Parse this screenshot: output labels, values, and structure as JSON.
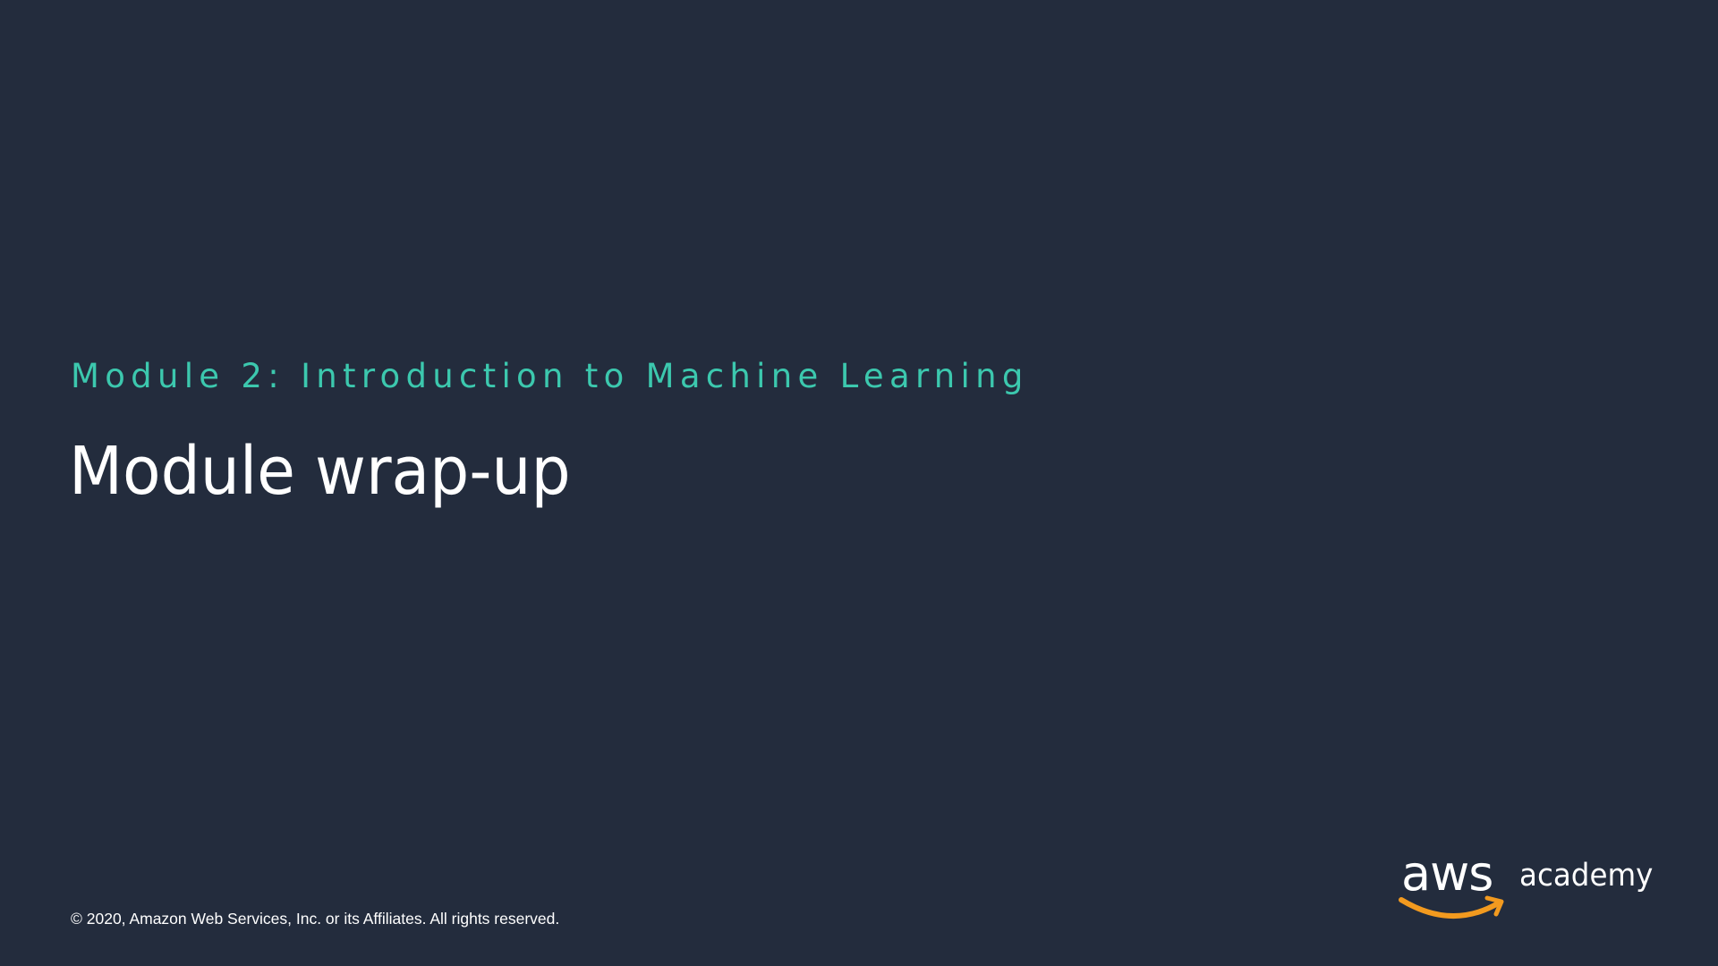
{
  "slide": {
    "module_label": "Module 2: Introduction to Machine Learning",
    "title": "Module wrap-up",
    "copyright": "© 2020, Amazon Web Services, Inc. or its Affiliates. All rights reserved."
  },
  "logo": {
    "aws_text": "aws",
    "academy_text": "academy"
  },
  "colors": {
    "background": "#232c3d",
    "accent": "#3cc8ae",
    "text": "#ffffff",
    "logo_smile": "#f29a1f"
  }
}
